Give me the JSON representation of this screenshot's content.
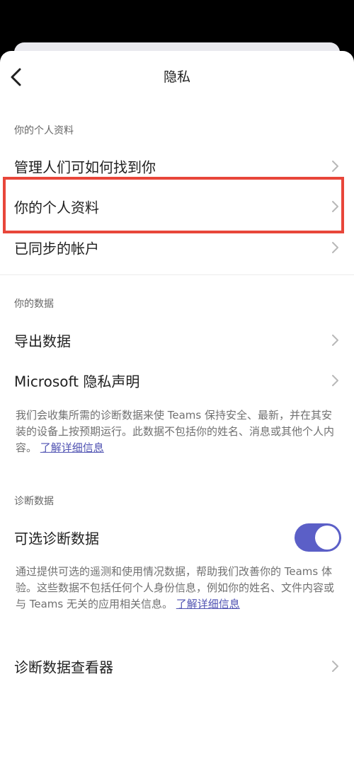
{
  "header": {
    "title": "隐私"
  },
  "sections": {
    "profile": {
      "title": "你的个人资料",
      "items": [
        {
          "label": "管理人们可如何找到你"
        },
        {
          "label": "你的个人资料"
        },
        {
          "label": "已同步的帐户"
        }
      ]
    },
    "data": {
      "title": "你的数据",
      "items": [
        {
          "label": "导出数据"
        },
        {
          "label": "Microsoft 隐私声明"
        }
      ],
      "description": "我们会收集所需的诊断数据来使 Teams 保持安全、最新，并在其安装的设备上按预期运行。此数据不包括你的姓名、消息或其他个人内容。",
      "link": "了解详细信息"
    },
    "diagnostics": {
      "title": "诊断数据",
      "toggle_label": "可选诊断数据",
      "toggle_on": true,
      "description": "通过提供可选的遥测和使用情况数据，帮助我们改善你的 Teams 体验。这些数据不包括任何个人身份信息，例如你的姓名、文件内容或与 Teams 无关的应用相关信息。",
      "link": "了解详细信息",
      "viewer_label": "诊断数据查看器"
    }
  },
  "colors": {
    "accent": "#5b5fc7",
    "highlight": "#e8463a",
    "link": "#4f52b2"
  }
}
